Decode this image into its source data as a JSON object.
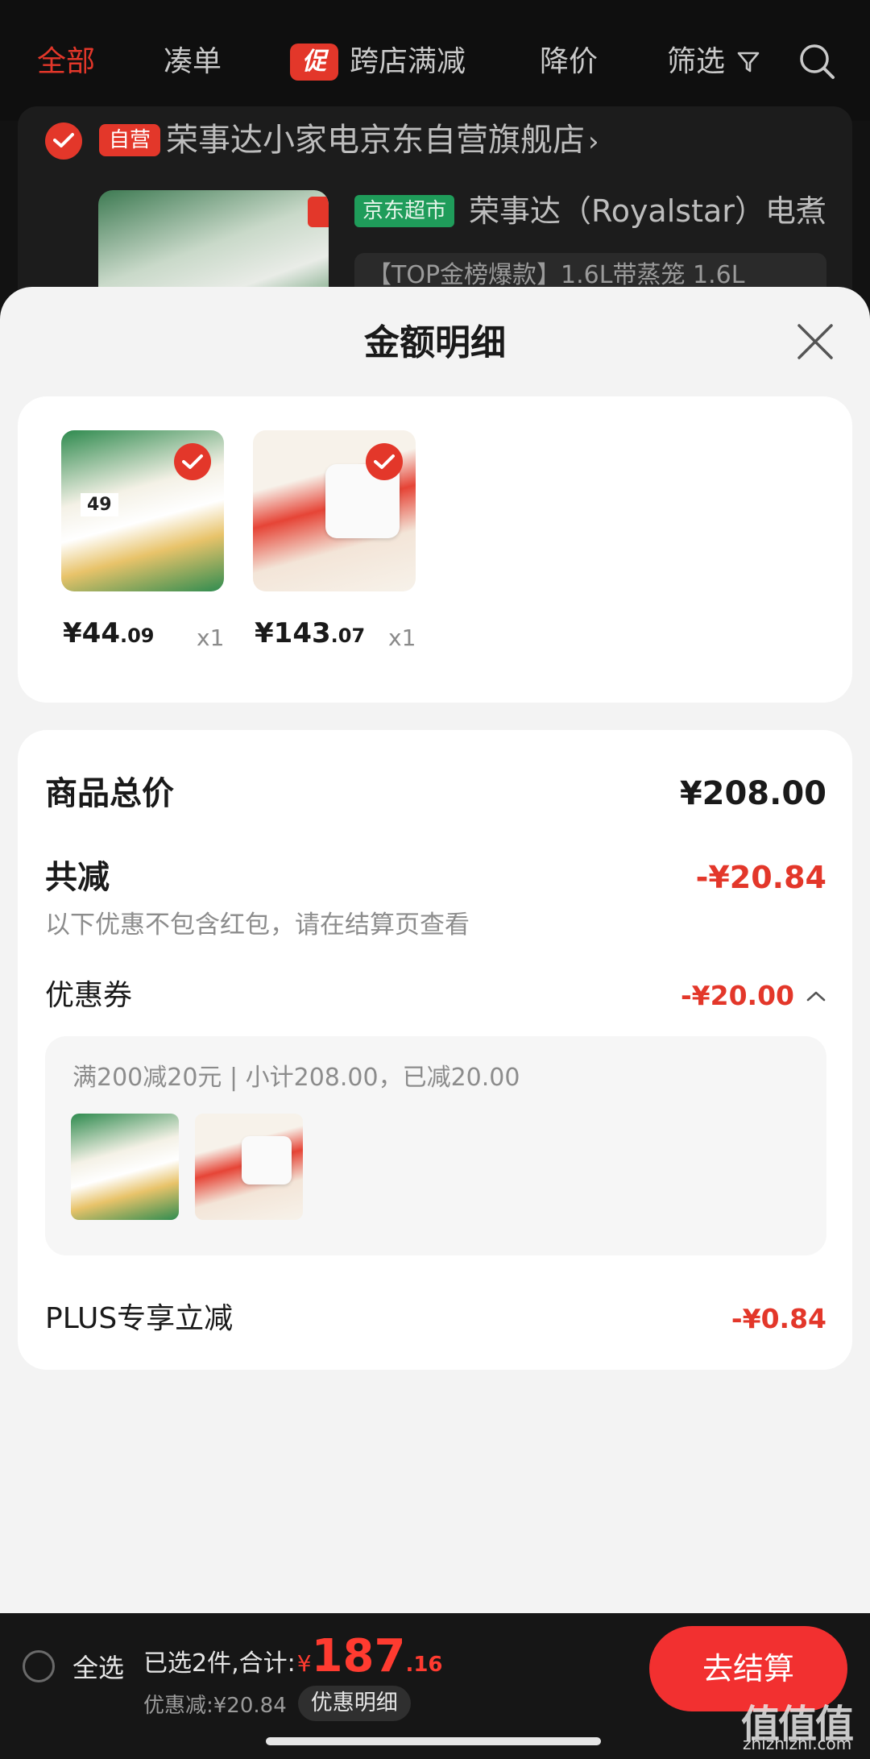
{
  "tabs": {
    "all": "全部",
    "combine": "凑单",
    "promo_badge": "促",
    "cross_store": "跨店满减",
    "price_drop": "降价",
    "filter": "筛选"
  },
  "shop": {
    "self_badge": "自营",
    "name": "荣事达小家电京东自营旗舰店",
    "chevron": "›",
    "market_badge": "京东超市",
    "product_title": "荣事达（Royalstar）电煮",
    "variant": "【TOP金榜爆款】1.6L带蒸笼 1.6L"
  },
  "sheet": {
    "title": "金额明细",
    "items": [
      {
        "price_int": "¥44",
        "price_dec": ".09",
        "qty": "x1"
      },
      {
        "price_int": "¥143",
        "price_dec": ".07",
        "qty": "x1"
      }
    ],
    "total_label": "商品总价",
    "total_value": "¥208.00",
    "reduce_label": "共减",
    "reduce_value": "-¥20.84",
    "note": "以下优惠不包含红包，请在结算页查看",
    "coupon_label": "优惠券",
    "coupon_value": "-¥20.00",
    "coupon_desc": "满200减20元 | 小计208.00，已减20.00",
    "plus_label": "PLUS专享立减",
    "plus_value": "-¥0.84"
  },
  "bottom": {
    "select_all": "全选",
    "selected_text": "已选2件,合计:",
    "currency": "¥",
    "total_int": "187",
    "total_dec": ".16",
    "discount_text": "优惠减:¥20.84",
    "detail_button": "优惠明细",
    "checkout_button": "去结算"
  },
  "watermark": {
    "logo": "值值值",
    "url": "zhizhizhi.com"
  },
  "colors": {
    "accent_red": "#e3372a",
    "checkout_red": "#f23030",
    "market_green": "#1f9c5a"
  }
}
